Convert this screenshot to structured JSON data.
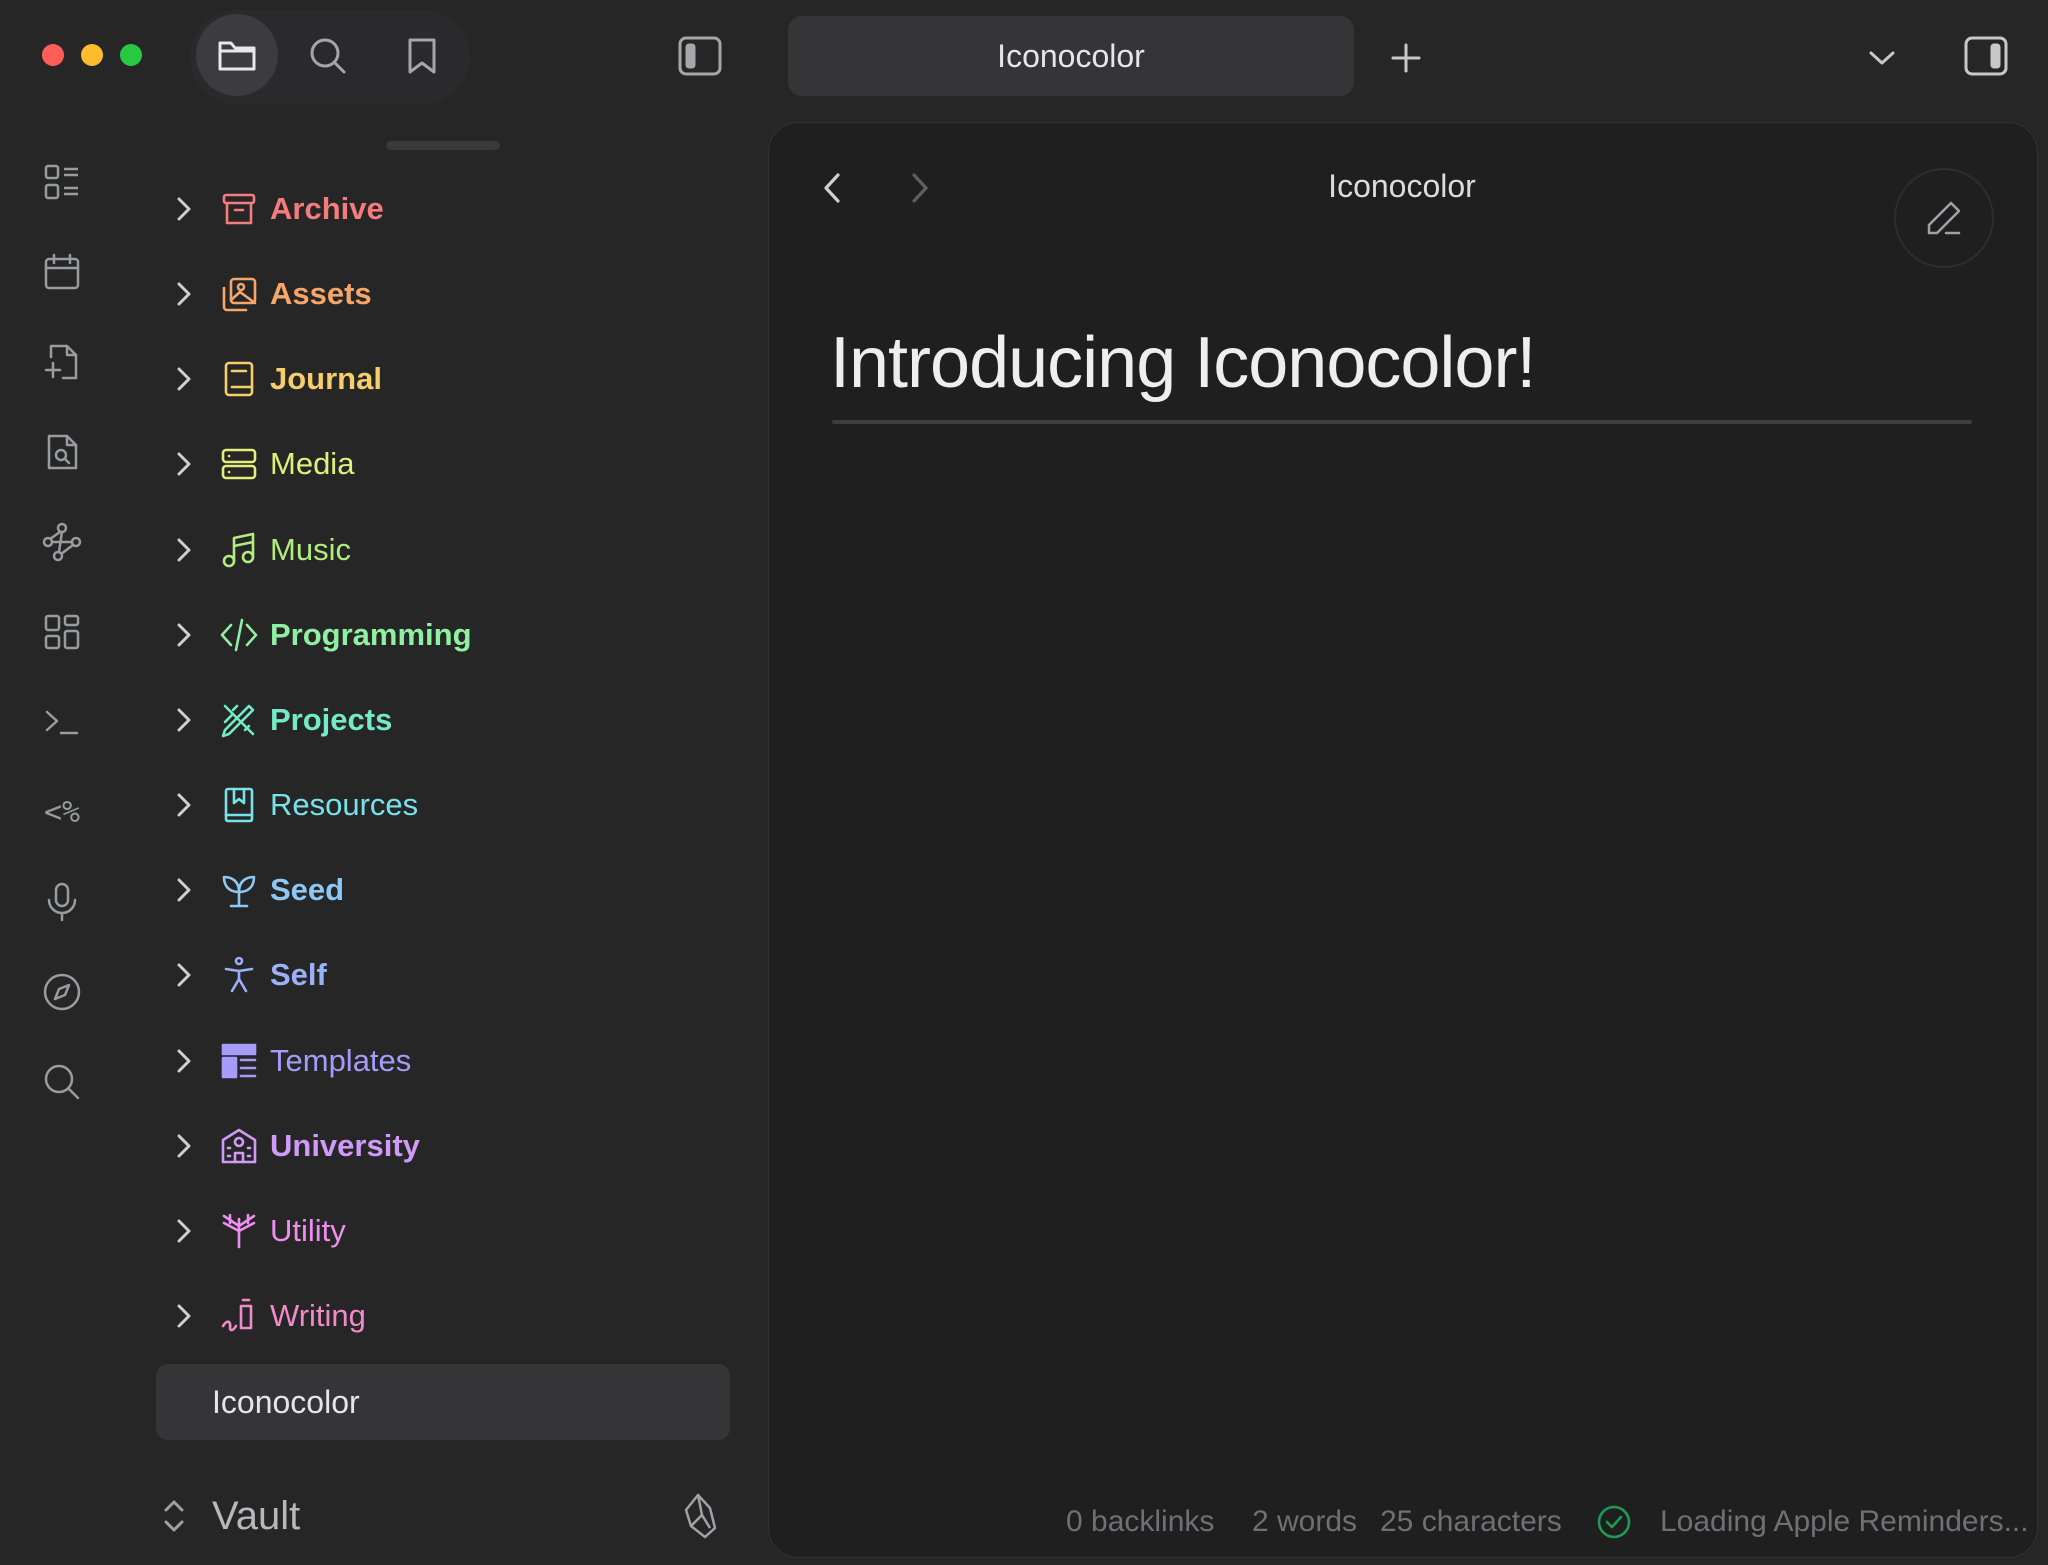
{
  "window": {
    "controls": {
      "close_color": "#ff5f57",
      "minimize_color": "#febc2e",
      "zoom_color": "#28c840"
    }
  },
  "top_bar": {
    "left_buttons": [
      {
        "name": "files",
        "icon": "folder-icon",
        "active": true
      },
      {
        "name": "search",
        "icon": "search-icon",
        "active": false
      },
      {
        "name": "bookmarks",
        "icon": "bookmark-icon",
        "active": false
      }
    ],
    "sidebar_toggle_icon": "sidebar-left-icon",
    "tab": {
      "title": "Iconocolor"
    },
    "new_tab_icon": "plus-icon",
    "tab_list_icon": "chevron-down-icon",
    "right_sidebar_toggle_icon": "sidebar-right-icon"
  },
  "ribbon": [
    {
      "icon": "dashboard-list-icon"
    },
    {
      "icon": "calendar-icon"
    },
    {
      "icon": "file-plus-icon"
    },
    {
      "icon": "file-search-icon"
    },
    {
      "icon": "graph-icon"
    },
    {
      "icon": "grid-icon"
    },
    {
      "icon": "terminal-icon"
    },
    {
      "icon": "templater-icon",
      "text": "<%"
    },
    {
      "icon": "microphone-icon"
    },
    {
      "icon": "compass-icon"
    },
    {
      "icon": "search-icon"
    }
  ],
  "file_tree": {
    "folders": [
      {
        "label": "Archive",
        "icon": "archive-icon",
        "color": "#f47c7c",
        "bold": true
      },
      {
        "label": "Assets",
        "icon": "images-icon",
        "color": "#f7a66a",
        "bold": true
      },
      {
        "label": "Journal",
        "icon": "book-icon",
        "color": "#f6cf6b",
        "bold": true
      },
      {
        "label": "Media",
        "icon": "server-icon",
        "color": "#dff07a",
        "bold": false
      },
      {
        "label": "Music",
        "icon": "music-icon",
        "color": "#b2ec7c",
        "bold": false
      },
      {
        "label": "Programming",
        "icon": "code-icon",
        "color": "#8ff0a2",
        "bold": true
      },
      {
        "label": "Projects",
        "icon": "ruler-pencil-icon",
        "color": "#73ebc6",
        "bold": true
      },
      {
        "label": "Resources",
        "icon": "book-bookmark-icon",
        "color": "#78e2ea",
        "bold": false
      },
      {
        "label": "Seed",
        "icon": "sprout-icon",
        "color": "#8dc8f5",
        "bold": true
      },
      {
        "label": "Self",
        "icon": "person-icon",
        "color": "#9ab0f8",
        "bold": true
      },
      {
        "label": "Templates",
        "icon": "layout-icon",
        "color": "#a79bfa",
        "bold": false
      },
      {
        "label": "University",
        "icon": "school-icon",
        "color": "#d09af8",
        "bold": true
      },
      {
        "label": "Utility",
        "icon": "antenna-icon",
        "color": "#ee8ff0",
        "bold": false
      },
      {
        "label": "Writing",
        "icon": "writing-icon",
        "color": "#f08ac8",
        "bold": false
      }
    ],
    "active_file": "Iconocolor"
  },
  "vault": {
    "name": "Vault",
    "switch_icon": "chevron-up-down-icon",
    "help_icon": "obsidian-logo-icon"
  },
  "pane": {
    "title": "Iconocolor",
    "back_icon": "chevron-left-icon",
    "forward_icon": "chevron-right-icon",
    "edit_icon": "pencil-icon",
    "document": {
      "heading": "Introducing Iconocolor!"
    }
  },
  "status_bar": {
    "backlinks": "0 backlinks",
    "words": "2 words",
    "characters": "25 characters",
    "sync_icon": "check-circle-icon",
    "reminders": "Loading Apple Reminders..."
  }
}
